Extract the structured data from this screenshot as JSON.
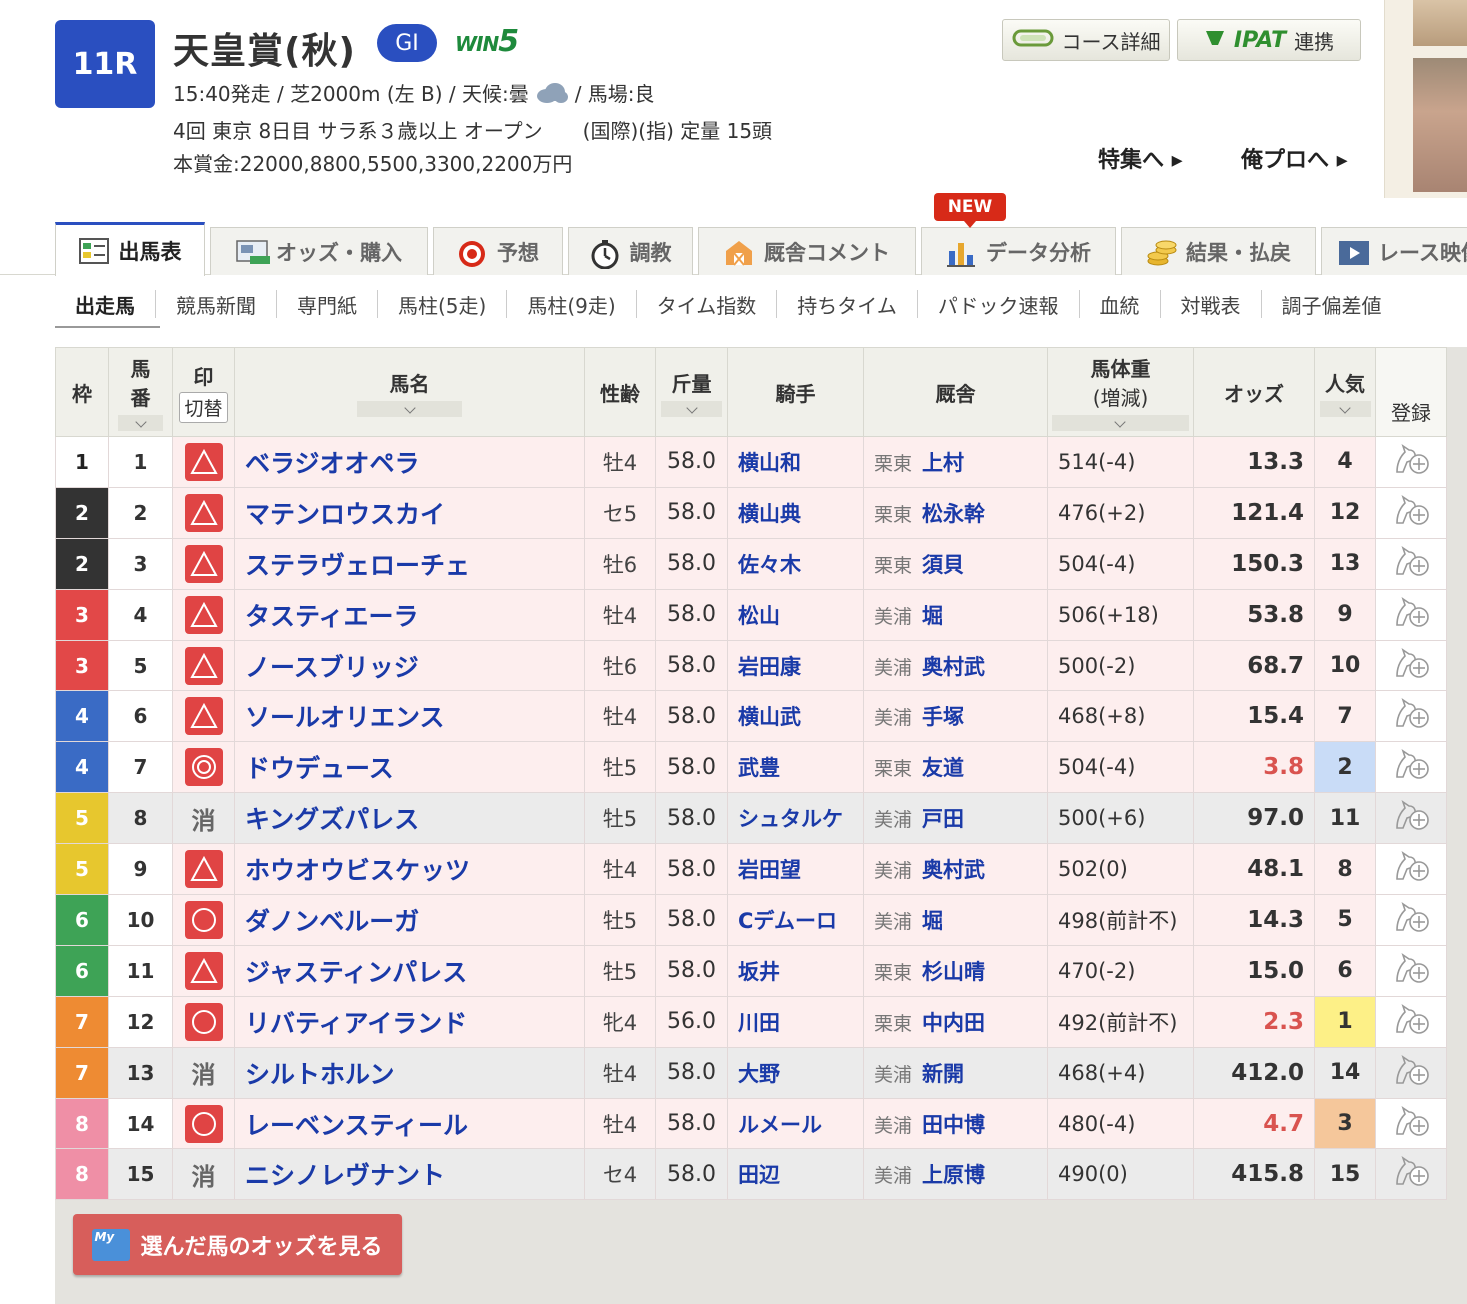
{
  "race": {
    "number": "11R",
    "name": "天皇賞(秋)",
    "grade": "GI",
    "win5": "WIN",
    "win5_num": "5",
    "info1_a": "15:40発走 / 芝2000m (左 B) / 天候:曇",
    "info1_b": "/ 馬場:良",
    "info2": "4回 東京 8日目 サラ系３歳以上 オープン　　(国際)(指) 定量 15頭",
    "info3": "本賞金:22000,8800,5500,3300,2200万円"
  },
  "header_buttons": {
    "course": "コース詳細",
    "ipat_logo": "IPAT",
    "ipat": "連携",
    "feature": "特集へ ▸",
    "orepro": "俺プロへ ▸"
  },
  "tabs": [
    {
      "label": "出馬表"
    },
    {
      "label": "オッズ・購入"
    },
    {
      "label": "予想"
    },
    {
      "label": "調教"
    },
    {
      "label": "厩舎コメント"
    },
    {
      "label": "データ分析"
    },
    {
      "label": "結果・払戻"
    },
    {
      "label": "レース映像"
    }
  ],
  "new_badge": "NEW",
  "subtabs": [
    "出走馬",
    "競馬新聞",
    "専門紙",
    "馬柱(5走)",
    "馬柱(9走)",
    "タイム指数",
    "持ちタイム",
    "パドック速報",
    "血統",
    "対戦表",
    "調子偏差値"
  ],
  "table_headers": {
    "waku": "枠",
    "umaban_1": "馬",
    "umaban_2": "番",
    "mark": "印",
    "mark_toggle": "切替",
    "horse": "馬名",
    "sexage": "性齢",
    "weight": "斤量",
    "jockey": "騎手",
    "stable": "厩舎",
    "bw_1": "馬体重",
    "bw_2": "(増減)",
    "odds": "オッズ",
    "pop": "人気",
    "reg": "登録"
  },
  "waku_colors": {
    "1": [
      "#ffffff",
      "#222222"
    ],
    "2": [
      "#333333",
      "#ffffff"
    ],
    "3": [
      "#e24848",
      "#ffffff"
    ],
    "4": [
      "#3a6bc5",
      "#ffffff"
    ],
    "5": [
      "#e7c72e",
      "#ffffff"
    ],
    "6": [
      "#3ea356",
      "#ffffff"
    ],
    "7": [
      "#ee8b33",
      "#ffffff"
    ],
    "8": [
      "#ef8fa6",
      "#ffffff"
    ]
  },
  "erased_mark": "消",
  "entries": [
    {
      "waku": "1",
      "umaban": "1",
      "mark": "triangle",
      "horse": "ベラジオオペラ",
      "sexage": "牡4",
      "weight": "58.0",
      "jockey": "横山和",
      "loc": "栗東",
      "trainer": "上村",
      "bw": "514(-4)",
      "odds": "13.3",
      "pop": "4"
    },
    {
      "waku": "2",
      "umaban": "2",
      "mark": "triangle",
      "horse": "マテンロウスカイ",
      "sexage": "セ5",
      "weight": "58.0",
      "jockey": "横山典",
      "loc": "栗東",
      "trainer": "松永幹",
      "bw": "476(+2)",
      "odds": "121.4",
      "pop": "12"
    },
    {
      "waku": "2",
      "umaban": "3",
      "mark": "triangle",
      "horse": "ステラヴェローチェ",
      "sexage": "牡6",
      "weight": "58.0",
      "jockey": "佐々木",
      "loc": "栗東",
      "trainer": "須貝",
      "bw": "504(-4)",
      "odds": "150.3",
      "pop": "13"
    },
    {
      "waku": "3",
      "umaban": "4",
      "mark": "triangle",
      "horse": "タスティエーラ",
      "sexage": "牡4",
      "weight": "58.0",
      "jockey": "松山",
      "loc": "美浦",
      "trainer": "堀",
      "bw": "506(+18)",
      "odds": "53.8",
      "pop": "9"
    },
    {
      "waku": "3",
      "umaban": "5",
      "mark": "triangle",
      "horse": "ノースブリッジ",
      "sexage": "牡6",
      "weight": "58.0",
      "jockey": "岩田康",
      "loc": "美浦",
      "trainer": "奥村武",
      "bw": "500(-2)",
      "odds": "68.7",
      "pop": "10"
    },
    {
      "waku": "4",
      "umaban": "6",
      "mark": "triangle",
      "horse": "ソールオリエンス",
      "sexage": "牡4",
      "weight": "58.0",
      "jockey": "横山武",
      "loc": "美浦",
      "trainer": "手塚",
      "bw": "468(+8)",
      "odds": "15.4",
      "pop": "7"
    },
    {
      "waku": "4",
      "umaban": "7",
      "mark": "double",
      "horse": "ドウデュース",
      "sexage": "牡5",
      "weight": "58.0",
      "jockey": "武豊",
      "loc": "栗東",
      "trainer": "友道",
      "bw": "504(-4)",
      "odds": "3.8",
      "pop": "2"
    },
    {
      "waku": "5",
      "umaban": "8",
      "mark": "erased",
      "horse": "キングズパレス",
      "sexage": "牡5",
      "weight": "58.0",
      "jockey": "シュタルケ",
      "loc": "美浦",
      "trainer": "戸田",
      "bw": "500(+6)",
      "odds": "97.0",
      "pop": "11"
    },
    {
      "waku": "5",
      "umaban": "9",
      "mark": "triangle",
      "horse": "ホウオウビスケッツ",
      "sexage": "牡4",
      "weight": "58.0",
      "jockey": "岩田望",
      "loc": "美浦",
      "trainer": "奥村武",
      "bw": "502(0)",
      "odds": "48.1",
      "pop": "8"
    },
    {
      "waku": "6",
      "umaban": "10",
      "mark": "circle",
      "horse": "ダノンベルーガ",
      "sexage": "牡5",
      "weight": "58.0",
      "jockey": "Cデムーロ",
      "loc": "美浦",
      "trainer": "堀",
      "bw": "498(前計不)",
      "odds": "14.3",
      "pop": "5"
    },
    {
      "waku": "6",
      "umaban": "11",
      "mark": "triangle",
      "horse": "ジャスティンパレス",
      "sexage": "牡5",
      "weight": "58.0",
      "jockey": "坂井",
      "loc": "栗東",
      "trainer": "杉山晴",
      "bw": "470(-2)",
      "odds": "15.0",
      "pop": "6"
    },
    {
      "waku": "7",
      "umaban": "12",
      "mark": "circle",
      "horse": "リバティアイランド",
      "sexage": "牝4",
      "weight": "56.0",
      "jockey": "川田",
      "loc": "栗東",
      "trainer": "中内田",
      "bw": "492(前計不)",
      "odds": "2.3",
      "pop": "1"
    },
    {
      "waku": "7",
      "umaban": "13",
      "mark": "erased",
      "horse": "シルトホルン",
      "sexage": "牡4",
      "weight": "58.0",
      "jockey": "大野",
      "loc": "美浦",
      "trainer": "新開",
      "bw": "468(+4)",
      "odds": "412.0",
      "pop": "14"
    },
    {
      "waku": "8",
      "umaban": "14",
      "mark": "circle",
      "horse": "レーベンスティール",
      "sexage": "牡4",
      "weight": "58.0",
      "jockey": "ルメール",
      "loc": "美浦",
      "trainer": "田中博",
      "bw": "480(-4)",
      "odds": "4.7",
      "pop": "3"
    },
    {
      "waku": "8",
      "umaban": "15",
      "mark": "erased",
      "horse": "ニシノレヴナント",
      "sexage": "セ4",
      "weight": "58.0",
      "jockey": "田辺",
      "loc": "美浦",
      "trainer": "上原博",
      "bw": "490(0)",
      "odds": "415.8",
      "pop": "15"
    }
  ],
  "odds_button": {
    "icon": "My",
    "label": "選んだ馬のオッズを見る"
  },
  "colors": {
    "race_blue": "#2a4fc0",
    "mark_red": "#e04444",
    "hot_odds": "#d9534f",
    "pop1": "#fdf087",
    "pop2": "#c9dcf7",
    "pop3": "#f5c79b"
  }
}
